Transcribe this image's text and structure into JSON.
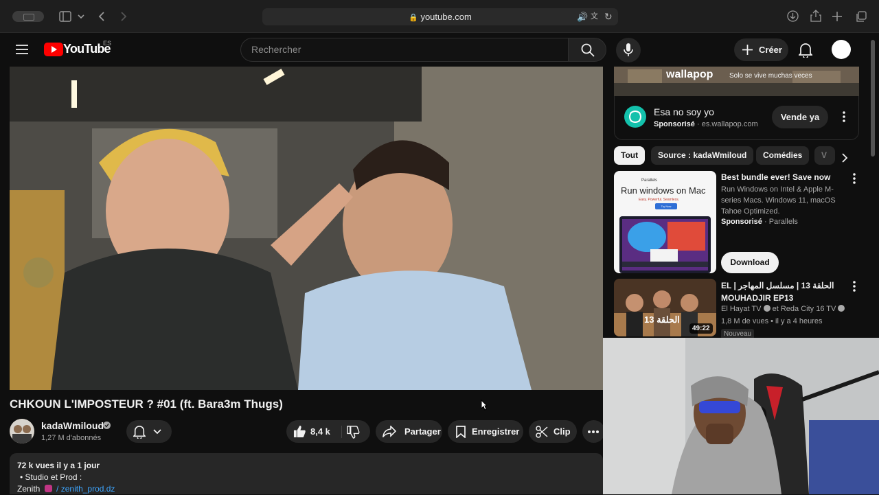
{
  "browser": {
    "url": "youtube.com"
  },
  "header": {
    "logo_text": "YouTube",
    "region": "ES",
    "search_placeholder": "Rechercher",
    "create_label": "Créer"
  },
  "video": {
    "title": "CHKOUN L'IMPOSTEUR ? #01 (ft. Bara3m Thugs)",
    "channel_name": "kadaWmiloud",
    "subscribers": "1,27 M d'abonnés",
    "likes": "8,4 k",
    "share_label": "Partager",
    "save_label": "Enregistrer",
    "clip_label": "Clip"
  },
  "description": {
    "stats": "72 k vues  il y a 1 jour",
    "bullet": "Studio et Prod :",
    "line3_prefix": "Zenith",
    "line3_link": "/ zenith_prod.dz"
  },
  "ad_banner": {
    "brand": "wallapop",
    "tagline": "Solo se vive muchas veces",
    "title": "Esa no soy yo",
    "sponsored": "Sponsorisé",
    "domain": "es.wallapop.com",
    "cta": "Vende ya"
  },
  "chips": [
    "Tout",
    "Source : kadaWmiloud",
    "Comédies",
    "V"
  ],
  "recommendations": [
    {
      "title": "Best bundle ever! Save now",
      "desc_line1": "Run Windows on Intel & Apple M-",
      "desc_line2": "series Macs. Windows 11, macOS",
      "desc_line3": "Tahoe Optimized.",
      "sponsored": "Sponsorisé",
      "advertiser": "Parallels",
      "cta": "Download",
      "thumb_brand": "Parallels",
      "thumb_headline": "Run windows on Mac",
      "thumb_sub": "Easy. Powerful. Seamless.",
      "thumb_btn": "Try Now"
    },
    {
      "title_line1": "EL | الحلقة 13 | مسلسل المهاجر",
      "title_line2": "MOUHADJIR EP13",
      "channel": "El Hayat TV",
      "channel2": "et Reda City 16 TV",
      "meta": "1,8 M de vues • il y a 4 heures",
      "badge": "Nouveau",
      "duration": "49:22",
      "thumb_text": "الحلقة 13"
    }
  ],
  "colors": {
    "youtube_red": "#ff0000",
    "wallapop_green": "#13c1ac",
    "background": "#0f0f0f"
  }
}
